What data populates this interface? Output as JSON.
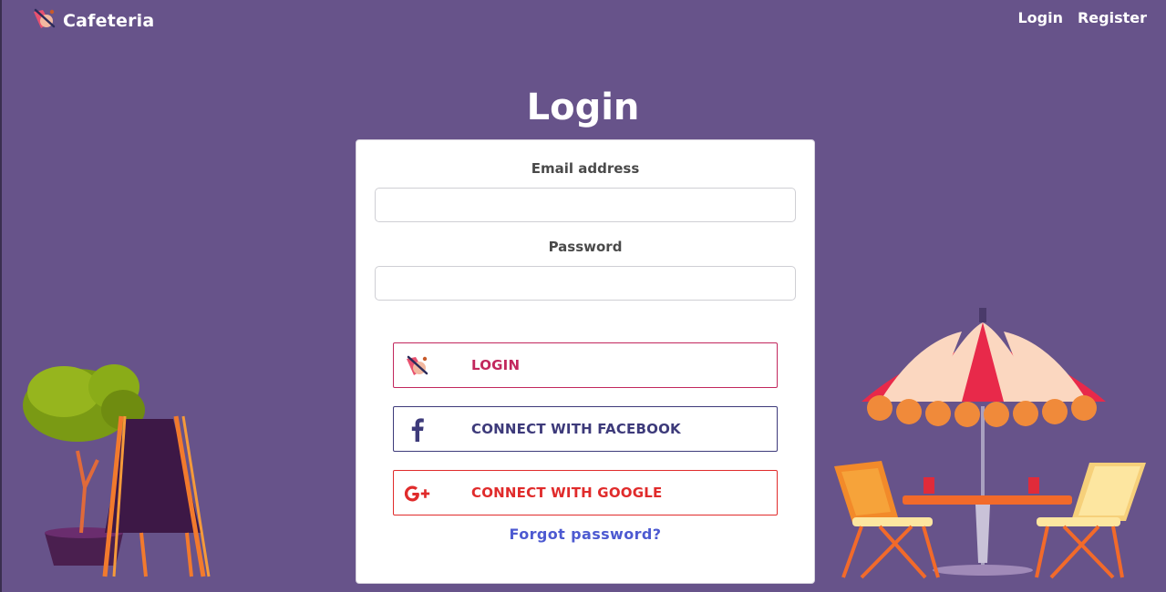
{
  "app": {
    "brand_name": "Cafeteria",
    "brand_icon": "cafeteria-logo-icon"
  },
  "nav": {
    "links": [
      {
        "label": "Login"
      },
      {
        "label": "Register"
      }
    ]
  },
  "page": {
    "title": "Login"
  },
  "form": {
    "email": {
      "label": "Email address",
      "value": "",
      "placeholder": ""
    },
    "password": {
      "label": "Password",
      "value": "",
      "placeholder": ""
    }
  },
  "buttons": {
    "login": {
      "label": "LOGIN",
      "icon": "cafeteria-logo-icon"
    },
    "facebook": {
      "label": "CONNECT WITH FACEBOOK",
      "icon": "facebook-icon"
    },
    "google": {
      "label": "CONNECT WITH GOOGLE",
      "icon": "google-plus-icon"
    }
  },
  "links": {
    "forgot_password": "Forgot password?"
  },
  "colors": {
    "background": "#67538a",
    "login_accent": "#c2275d",
    "facebook_accent": "#3d3a7a",
    "google_accent": "#e02b2b",
    "link": "#4d5ad1"
  },
  "illustrations": {
    "left": "plant-and-chalkboard-illustration",
    "right": "cafe-umbrella-table-illustration"
  }
}
